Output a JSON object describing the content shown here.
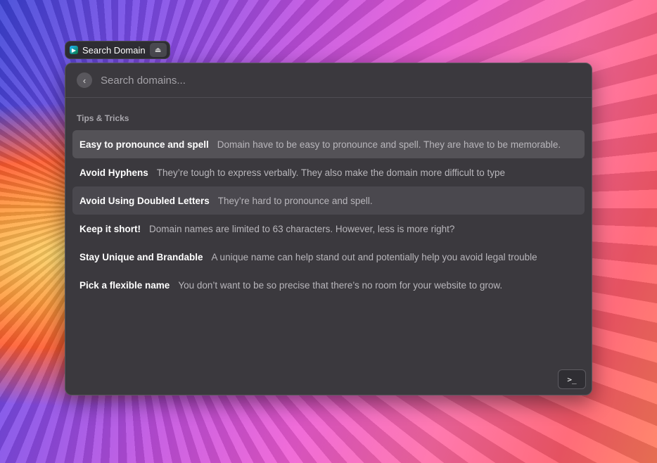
{
  "header": {
    "title": "Search Domain",
    "app_icon": "domain-app-icon",
    "button_icon": "drive-icon"
  },
  "search": {
    "placeholder": "Search domains...",
    "value": "",
    "back_icon": "chevron-left-icon"
  },
  "section": {
    "title": "Tips & Tricks"
  },
  "items": [
    {
      "title": "Easy to pronounce and spell",
      "desc": "Domain have to be easy to pronounce and spell. They are have to be memorable.",
      "state": "selected"
    },
    {
      "title": "Avoid Hyphens",
      "desc": "They’re tough to express verbally. They also make the domain more difficult to type",
      "state": ""
    },
    {
      "title": "Avoid Using Doubled Letters",
      "desc": "They’re hard to pronounce and spell.",
      "state": "hover"
    },
    {
      "title": "Keep it short!",
      "desc": "Domain names are limited to 63 characters. However, less is more right?",
      "state": ""
    },
    {
      "title": "Stay Unique and Brandable",
      "desc": "A unique name can help stand out and potentially help you avoid legal trouble",
      "state": ""
    },
    {
      "title": "Pick a flexible name",
      "desc": "You don’t want to be so precise that there’s no room for your website to grow.",
      "state": ""
    }
  ],
  "footer": {
    "action_icon": "terminal-icon",
    "action_glyph": ">_"
  }
}
